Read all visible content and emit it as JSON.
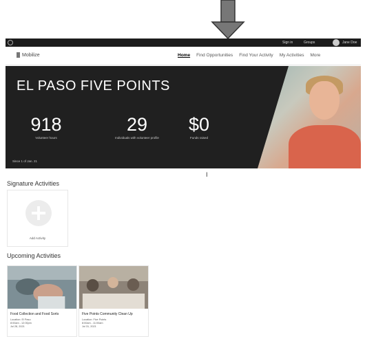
{
  "topbar": {
    "links": [
      "Sign in",
      "Groups",
      "Jane Doe"
    ]
  },
  "nav": {
    "brand": "Mobilize",
    "items": [
      "Home",
      "Find Opportunities",
      "Find Your Activity",
      "My Activities",
      "More"
    ]
  },
  "hero": {
    "title": "EL PASO FIVE POINTS",
    "stats": [
      {
        "value": "918",
        "label": "Volunteer hours"
      },
      {
        "value": "29",
        "label": "Individuals with volunteer profile"
      },
      {
        "value": "$0",
        "label": "Funds raised"
      }
    ],
    "footnote": "Since 1 of Jan. 21"
  },
  "signature": {
    "title": "Signature Activities",
    "add_label": "Add Activity"
  },
  "upcoming": {
    "title": "Upcoming Activities",
    "cards": [
      {
        "title": "Food Collection and Food Sorts",
        "lines": [
          "Location: El Paso",
          "8:00am - 12:00pm",
          "Jul 28, 2021"
        ]
      },
      {
        "title": "Five Points Community Clean Up",
        "lines": [
          "Location: Five Points",
          "8:00am - 11:00am",
          "Jul 31, 2021"
        ]
      }
    ]
  }
}
